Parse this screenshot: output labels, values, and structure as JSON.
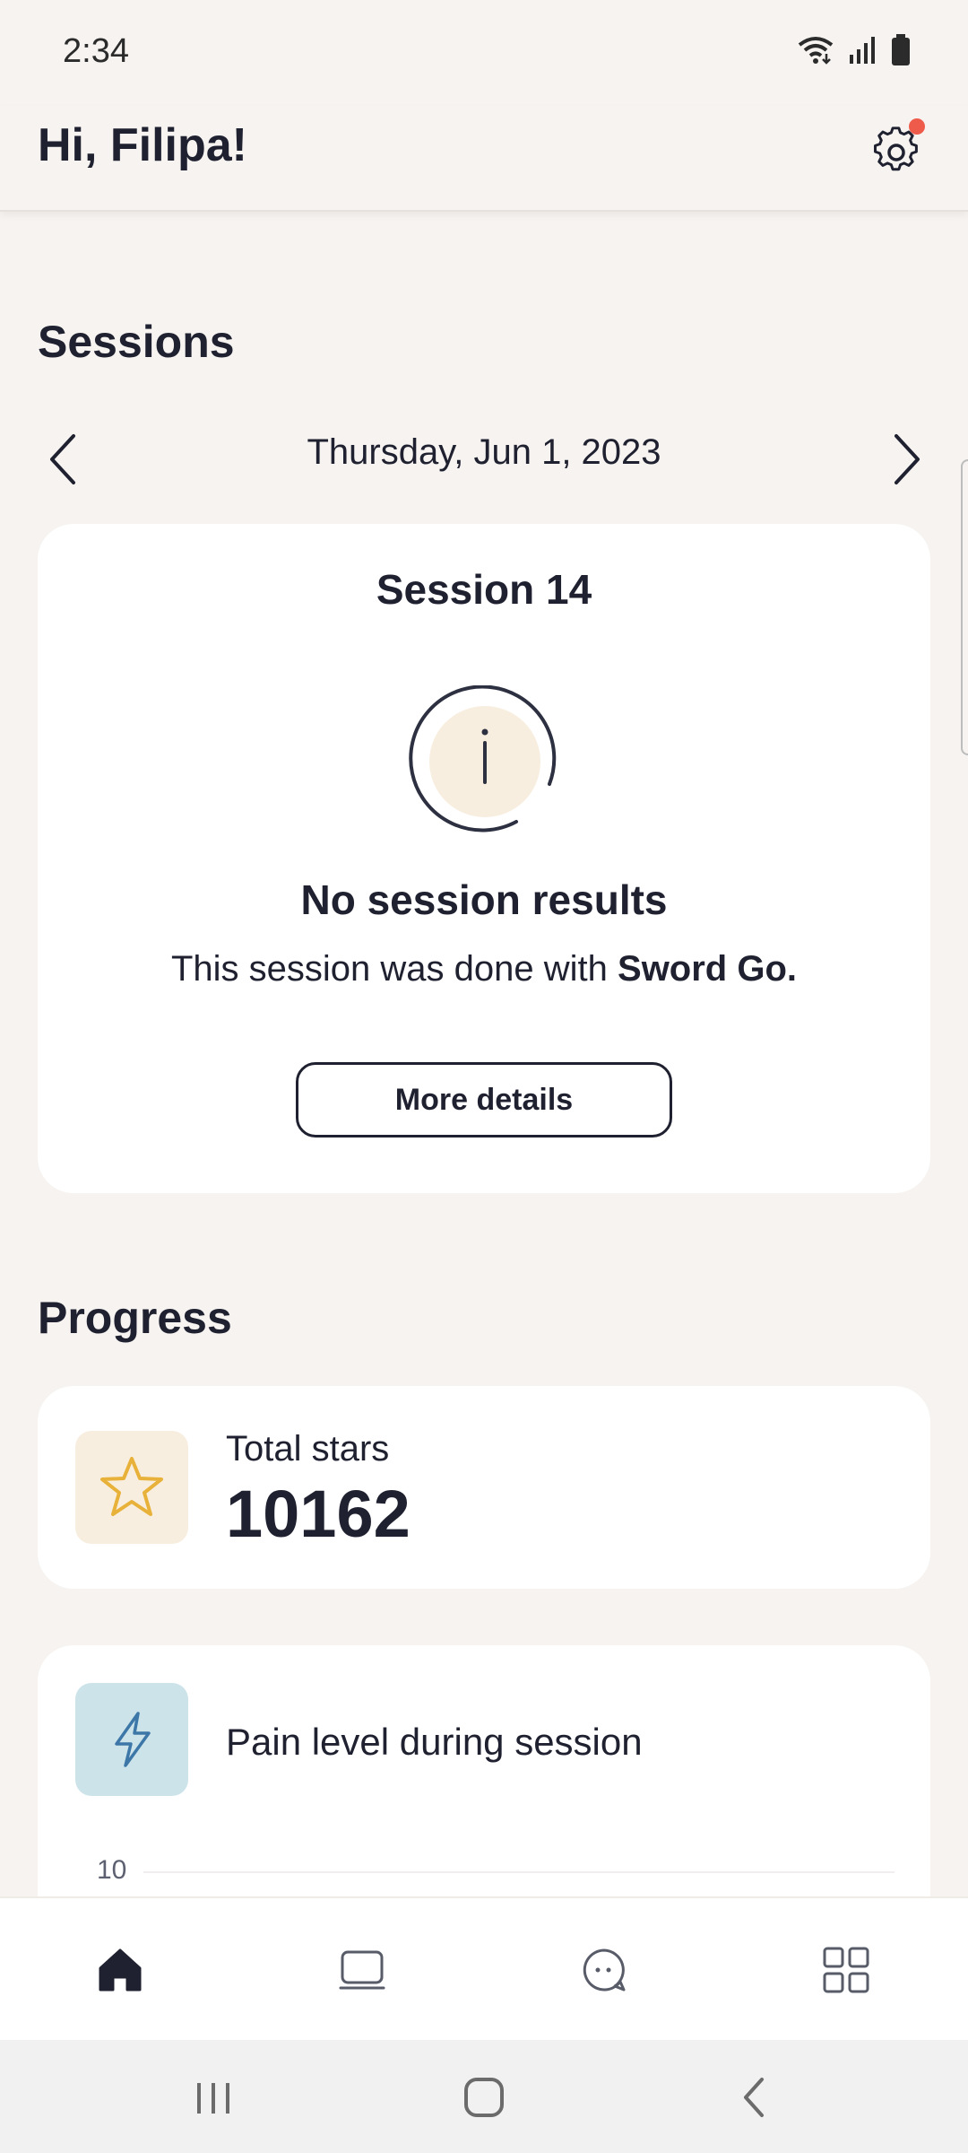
{
  "status_bar": {
    "time": "2:34",
    "icons": [
      "wifi-icon",
      "signal-icon",
      "battery-icon"
    ]
  },
  "header": {
    "greeting": "Hi, Filipa!",
    "settings_icon": "gear-icon",
    "notification_dot_color": "#ef5b4a"
  },
  "sessions": {
    "title": "Sessions",
    "date": "Thursday, Jun 1, 2023",
    "card": {
      "title": "Session 14",
      "info_icon": "info-icon",
      "heading": "No session results",
      "description_prefix": "This session was done with",
      "description_bold": "Sword Go.",
      "button_label": "More details"
    }
  },
  "progress": {
    "title": "Progress",
    "total_stars": {
      "label": "Total stars",
      "value": "10162",
      "icon": "star-icon",
      "icon_color": "#e8b23a"
    },
    "pain": {
      "label": "Pain level during session",
      "icon": "lightning-icon",
      "icon_color": "#3c77a8",
      "axis_top_tick": "10"
    }
  },
  "bottom_nav": {
    "items": [
      {
        "icon": "home-icon",
        "active": true
      },
      {
        "icon": "tablet-icon",
        "active": false
      },
      {
        "icon": "chat-icon",
        "active": false
      },
      {
        "icon": "grid-icon",
        "active": false
      }
    ]
  },
  "system_nav": {
    "buttons": [
      "recent-apps-icon",
      "home-circle-icon",
      "back-icon"
    ]
  },
  "colors": {
    "background": "#f6f3f0",
    "card": "#ffffff",
    "text": "#1f2130"
  }
}
